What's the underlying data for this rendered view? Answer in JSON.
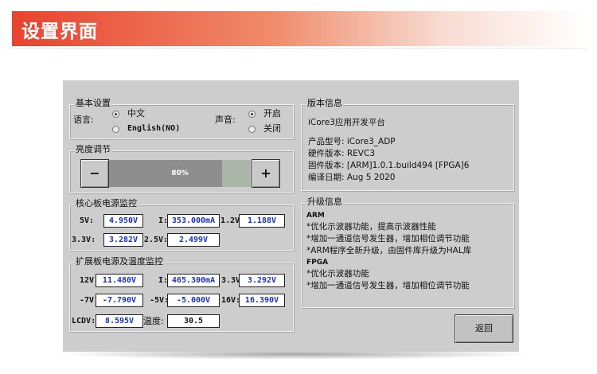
{
  "banner": {
    "title": "设置界面"
  },
  "basic": {
    "title": "基本设置",
    "language_label": "语言:",
    "language_options": [
      "中文",
      "English(NO)"
    ],
    "sound_label": "声音:",
    "sound_options": [
      "开启",
      "关闭"
    ]
  },
  "brightness": {
    "title": "亮度调节",
    "minus": "−",
    "plus": "+",
    "value_text": "80%",
    "level": 0.8
  },
  "core": {
    "title": "核心板电源监控",
    "rows": [
      {
        "label": "5V:",
        "value": "4.950V"
      },
      {
        "label": "I:",
        "value": "353.000mA"
      },
      {
        "label": "1.2V:",
        "value": "1.188V"
      },
      {
        "label": "3.3V:",
        "value": "3.282V"
      },
      {
        "label": "2.5V:",
        "value": "2.499V"
      }
    ]
  },
  "ext": {
    "title": "扩展板电源及温度监控",
    "rows": [
      {
        "label": "12V:",
        "value": "11.480V"
      },
      {
        "label": "I:",
        "value": "465.300mA"
      },
      {
        "label": "3.3V:",
        "value": "3.292V"
      },
      {
        "label": "-7V:",
        "value": "-7.790V"
      },
      {
        "label": "-5V:",
        "value": "-5.000V"
      },
      {
        "label": "16V:",
        "value": "16.390V"
      },
      {
        "label": "LCDV:",
        "value": "8.595V"
      },
      {
        "label": "温度:",
        "value": "30.5"
      }
    ]
  },
  "version": {
    "title": "版本信息",
    "platform": "iCore3应用开发平台",
    "lines": [
      "产品型号: iCore3_ADP",
      "硬件版本: REVC3",
      "固件版本: [ARM]1.0.1.build494 [FPGA]6",
      "编译日期: Aug  5 2020"
    ]
  },
  "upgrade": {
    "title": "升级信息",
    "arm_heading": "ARM",
    "arm_lines": [
      "*优化示波器功能，提高示波器性能",
      "*增加一通道信号发生器，增加相位调节功能",
      "*ARM程序全新升级，由固件库升级为HAL库"
    ],
    "fpga_heading": "FPGA",
    "fpga_lines": [
      "*优化示波器功能",
      "*增加一通道信号发生器，增加相位调节功能"
    ]
  },
  "back_button": "返回"
}
